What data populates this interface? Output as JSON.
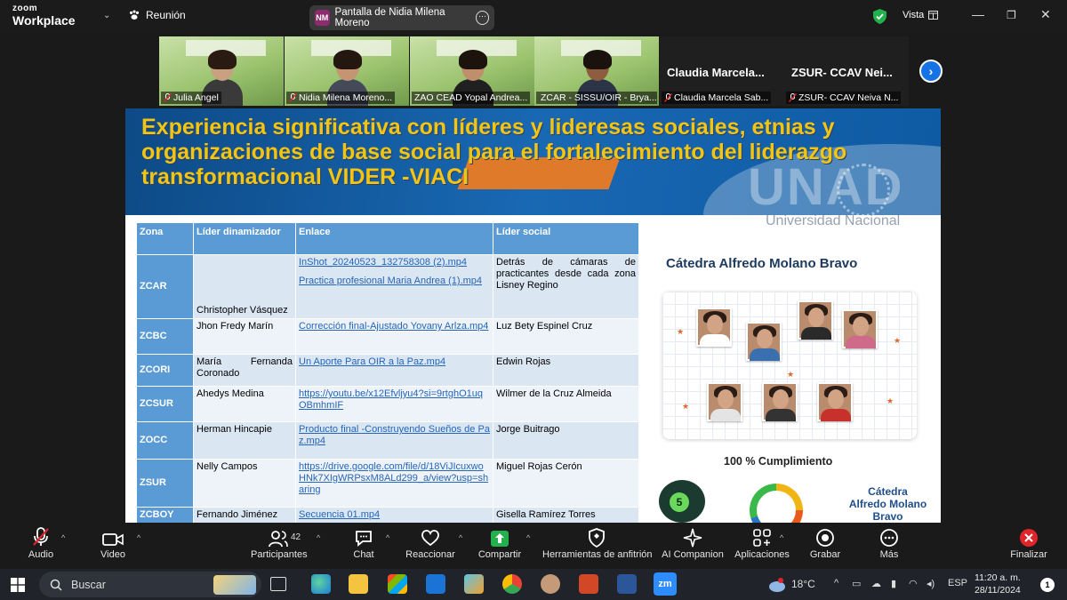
{
  "app": {
    "logo_top": "zoom",
    "logo_bottom": "Workplace",
    "meeting_label": "Reunión",
    "share_label": "Pantalla de Nidia Milena Moreno",
    "share_avatar": "NM",
    "view_label": "Vista"
  },
  "participants_strip": [
    {
      "name": "Julia Angel",
      "muted": true,
      "video": true,
      "skin": "#c9a080",
      "hair": "#2a1b12",
      "shirt": "#3a3a3a"
    },
    {
      "name": "Nidia Milena Moreno...",
      "muted": true,
      "video": true,
      "skin": "#c49473",
      "hair": "#23170f",
      "shirt": "#444a58"
    },
    {
      "name": "ZAO CEAD Yopal Andrea...",
      "muted": false,
      "video": true,
      "skin": "#bf8f6c",
      "hair": "#1c130d",
      "shirt": "#202020"
    },
    {
      "name": "ZCAR - SISSU/OIR - Brya...",
      "muted": true,
      "video": true,
      "active": true,
      "skin": "#8e5d40",
      "hair": "#1a120c",
      "shirt": "#2c3448"
    },
    {
      "name": "Claudia Marcela Sab...",
      "muted": true,
      "video": false,
      "big": "Claudia  Marcela..."
    },
    {
      "name": "ZSUR- CCAV Neiva N...",
      "muted": true,
      "video": false,
      "big": "ZSUR-  CCAV  Nei..."
    }
  ],
  "slide": {
    "title": "Experiencia significativa con líderes y lideresas sociales, etnias y organizaciones de base social para el fortalecimiento del liderazgo transformacional VIDER -VIACI",
    "watermark": "UNAD",
    "watermark_sub": "Universidad Nacional",
    "table": {
      "headers": [
        "Zona",
        "Líder dinamizador",
        "Enlace",
        "Líder social"
      ],
      "rows": [
        {
          "zone": "ZCAR",
          "leader": "Christopher Vásquez",
          "links": [
            "InShot_20240523_132758308 (2).mp4",
            "Practica profesional Maria Andrea (1).mp4"
          ],
          "social": "Detrás de cámaras de practicantes desde cada zona Lisney Regino"
        },
        {
          "zone": "ZCBC",
          "leader": "Jhon Fredy Marín",
          "links": [
            "Corrección final-Ajustado Yovany Arlza.mp4"
          ],
          "social": "Luz Bety Espinel Cruz"
        },
        {
          "zone": "ZCORI",
          "leader": "María Fernanda Coronado",
          "links": [
            "Un Aporte Para OIR a la Paz.mp4"
          ],
          "social": "Edwin Rojas"
        },
        {
          "zone": "ZCSUR",
          "leader": "Ahedys Medina",
          "links": [
            "https://youtu.be/x12Efvljyu4?si=9rtghO1uqOBmhmIF"
          ],
          "social": "Wilmer de la Cruz Almeida"
        },
        {
          "zone": "ZOCC",
          "leader": "Herman Hincapie",
          "links": [
            "Producto final -Construyendo Sueños de Paz.mp4"
          ],
          "social": "Jorge Buitrago"
        },
        {
          "zone": "ZSUR",
          "leader": "Nelly Campos",
          "links": [
            "https://drive.google.com/file/d/18ViJIcuxwoHNk7XIgWRPsxM8ALd299_a/view?usp=sharing"
          ],
          "social": "Miguel Rojas Cerón"
        },
        {
          "zone": "ZCBOY",
          "leader": "Fernando Jiménez",
          "links": [
            "Secuencia 01.mp4"
          ],
          "social": "Gisella Ramírez Torres"
        }
      ]
    },
    "panel": {
      "catedra": "Cátedra Alfredo Molano Bravo",
      "cumplimiento": "100 % Cumplimiento",
      "badge": "5",
      "catedra2_line1": "Cátedra",
      "catedra2_line2": "Alfredo Molano Bravo"
    }
  },
  "toolbar": {
    "audio": "Audio",
    "video": "Video",
    "participants": "Participantes",
    "participants_count": "42",
    "chat": "Chat",
    "react": "Reaccionar",
    "share": "Compartir",
    "host_tools": "Herramientas de anfitrión",
    "ai": "AI Companion",
    "apps": "Aplicaciones",
    "record": "Grabar",
    "more": "Más",
    "end": "Finalizar"
  },
  "taskbar": {
    "search_placeholder": "Buscar",
    "temp": "18°C",
    "lang": "ESP",
    "time": "11:20 a. m.",
    "date": "28/11/2024"
  },
  "colors": {
    "accent_green": "#35d35a",
    "zoom_blue": "#1673e6",
    "table_header": "#5b9bd5",
    "title_yellow": "#f2c512",
    "end_red": "#e0242a"
  }
}
